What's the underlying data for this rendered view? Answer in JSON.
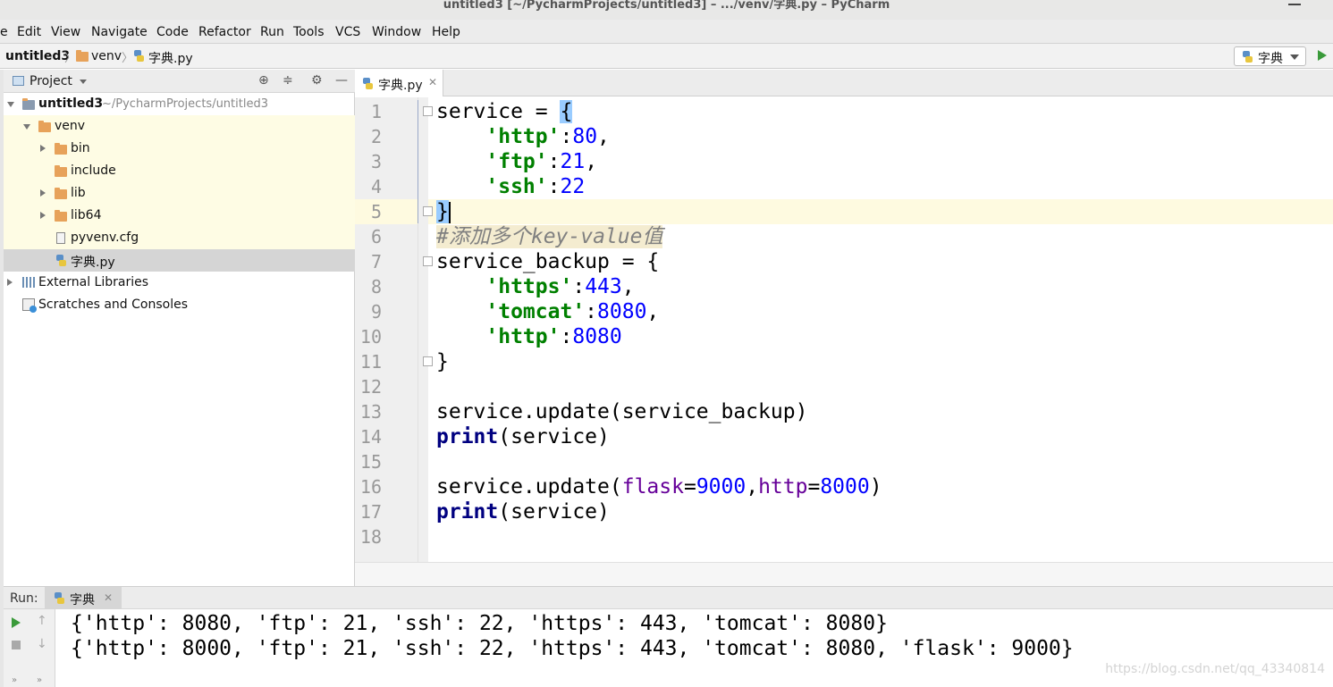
{
  "window": {
    "title": "untitled3 [~/PycharmProjects/untitled3] – .../venv/字典.py – PyCharm"
  },
  "menu": [
    "e",
    "Edit",
    "View",
    "Navigate",
    "Code",
    "Refactor",
    "Run",
    "Tools",
    "VCS",
    "Window",
    "Help"
  ],
  "breadcrumb": [
    "untitled3",
    "venv",
    "字典.py"
  ],
  "run_config": {
    "label": "字典"
  },
  "project_panel": {
    "title": "Project",
    "root": {
      "name": "untitled3",
      "path": "~/PycharmProjects/untitled3"
    },
    "items": [
      "venv",
      "bin",
      "include",
      "lib",
      "lib64",
      "pyvenv.cfg",
      "字典.py",
      "External Libraries",
      "Scratches and Consoles"
    ]
  },
  "editor": {
    "tab": "字典.py",
    "line_numbers": [
      "1",
      "2",
      "3",
      "4",
      "5",
      "6",
      "7",
      "8",
      "9",
      "10",
      "11",
      "12",
      "13",
      "14",
      "15",
      "16",
      "17",
      "18"
    ],
    "code": {
      "l1_var": "service",
      "l1_op": " = ",
      "l1_brace": "{",
      "l2_key": "'http'",
      "l2_val": "80",
      "l3_key": "'ftp'",
      "l3_val": "21",
      "l4_key": "'ssh'",
      "l4_val": "22",
      "l5_brace": "}",
      "l6_comment": "#添加多个key-value值",
      "l7_text": "service_backup = {",
      "l8_key": "'https'",
      "l8_val": "443",
      "l9_key": "'tomcat'",
      "l9_val": "8080",
      "l10_key": "'http'",
      "l10_val": "8080",
      "l11_text": "}",
      "l13_text": "service.update(service_backup)",
      "l14_kw": "print",
      "l14_rest": "(service)",
      "l16_start": "service.update(",
      "l16_p1": "flask",
      "l16_v1": "9000",
      "l16_p2": "http",
      "l16_v2": "8000",
      "l16_end": ")",
      "l17_kw": "print",
      "l17_rest": "(service)"
    }
  },
  "run_panel": {
    "label": "Run:",
    "tab": "字典",
    "output": [
      "{'http': 8080, 'ftp': 21, 'ssh': 22, 'https': 443, 'tomcat': 8080}",
      "{'http': 8000, 'ftp': 21, 'ssh': 22, 'https': 443, 'tomcat': 8080, 'flask': 9000}"
    ]
  },
  "watermark": "https://blog.csdn.net/qq_43340814"
}
